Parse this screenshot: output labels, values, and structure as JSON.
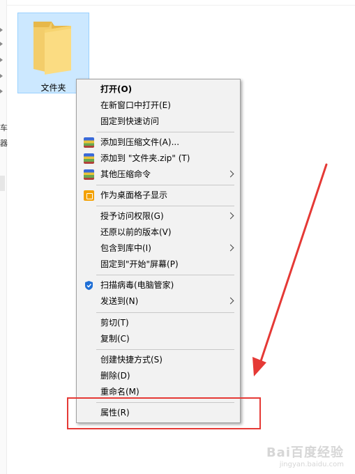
{
  "folder": {
    "name": "文件夹"
  },
  "sidebar_partial": [
    "车",
    "器"
  ],
  "context_menu": {
    "items": [
      {
        "label": "打开(O)",
        "bold": true
      },
      {
        "label": "在新窗口中打开(E)"
      },
      {
        "label": "固定到快速访问"
      },
      {
        "label": "添加到压缩文件(A)...",
        "icon": "winrar-icon"
      },
      {
        "label": "添加到 \"文件夹.zip\" (T)",
        "icon": "winrar-icon"
      },
      {
        "label": "其他压缩命令",
        "icon": "winrar-icon",
        "submenu": true
      },
      {
        "label": "作为桌面格子显示",
        "icon": "desktop-grid-icon"
      },
      {
        "label": "授予访问权限(G)",
        "submenu": true
      },
      {
        "label": "还原以前的版本(V)"
      },
      {
        "label": "包含到库中(I)",
        "submenu": true
      },
      {
        "label": "固定到\"开始\"屏幕(P)"
      },
      {
        "label": "扫描病毒(电脑管家)",
        "icon": "shield-icon"
      },
      {
        "label": "发送到(N)",
        "submenu": true
      },
      {
        "label": "剪切(T)"
      },
      {
        "label": "复制(C)"
      },
      {
        "label": "创建快捷方式(S)"
      },
      {
        "label": "删除(D)"
      },
      {
        "label": "重命名(M)"
      },
      {
        "label": "属性(R)"
      }
    ]
  },
  "annotation": {
    "highlight_color": "#e53935",
    "highlighted_item": "属性(R)"
  },
  "watermark": {
    "brand": "Bai百度经验",
    "url": "jingyan.baidu.com"
  }
}
